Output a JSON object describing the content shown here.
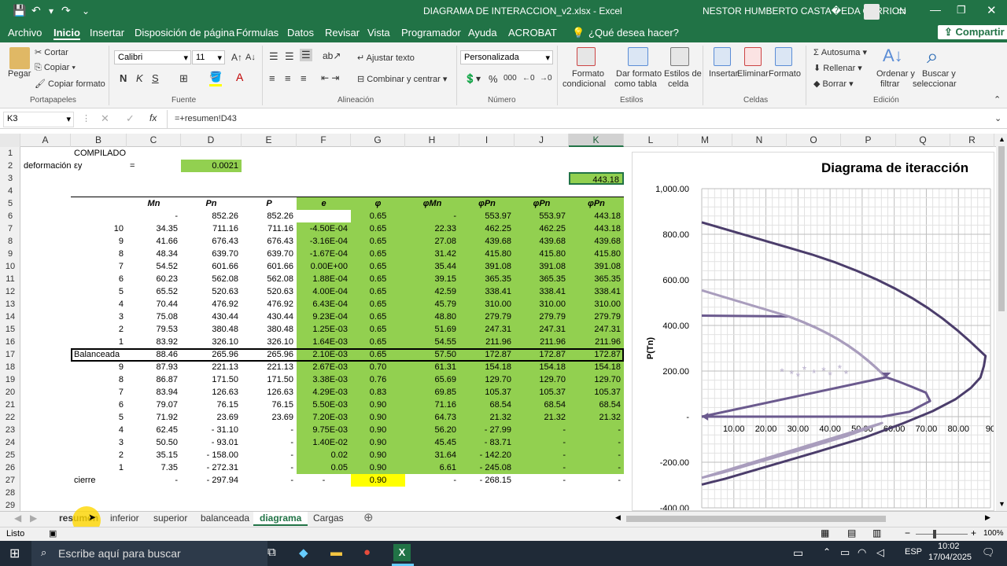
{
  "titlebar": {
    "filename": "DIAGRAMA DE INTERACCION_v2.xlsx - Excel",
    "user": "NESTOR HUMBERTO CASTA�EDA CARRION"
  },
  "menu": [
    "Archivo",
    "Inicio",
    "Insertar",
    "Disposición de página",
    "Fórmulas",
    "Datos",
    "Revisar",
    "Vista",
    "Programador",
    "Ayuda",
    "ACROBAT"
  ],
  "search": "¿Qué desea hacer?",
  "share": "Compartir",
  "ribbon": {
    "cortar": "Cortar",
    "copiar": "Copiar",
    "copiar_formato": "Copiar formato",
    "pegar": "Pegar",
    "portapapeles": "Portapapeles",
    "font": "Calibri",
    "size": "11",
    "fuente": "Fuente",
    "ajustar": "Ajustar texto",
    "combinar": "Combinar y centrar",
    "alineacion": "Alineación",
    "numfmt": "Personalizada",
    "numero": "Número",
    "formato_cond": "Formato",
    "formato_cond2": "condicional",
    "dar_formato": "Dar formato",
    "dar_formato2": "como tabla",
    "estilos_celda": "Estilos de",
    "estilos_celda2": "celda",
    "estilos": "Estilos",
    "insertar": "Insertar",
    "eliminar": "Eliminar",
    "formato": "Formato",
    "celdas": "Celdas",
    "autosuma": "Autosuma",
    "rellenar": "Rellenar",
    "borrar": "Borrar",
    "ordenar": "Ordenar y",
    "ordenar2": "filtrar",
    "buscar": "Buscar y",
    "buscar2": "seleccionar",
    "edicion": "Edición"
  },
  "formula": {
    "namebox": "K3",
    "content": "=+resumen!D43"
  },
  "columns": [
    "A",
    "B",
    "C",
    "D",
    "E",
    "F",
    "G",
    "H",
    "I",
    "J",
    "K",
    "L",
    "M",
    "N",
    "O",
    "P",
    "Q",
    "R"
  ],
  "rows": [
    "1",
    "2",
    "3",
    "4",
    "5",
    "6",
    "7",
    "8",
    "9",
    "10",
    "11",
    "12",
    "13",
    "14",
    "15",
    "16",
    "17",
    "18",
    "19",
    "20",
    "21",
    "22",
    "23",
    "24",
    "25",
    "26",
    "27",
    "28",
    "29"
  ],
  "cells": {
    "b1": "COMPILADO",
    "a2": "deformación",
    "b2": "εy",
    "c2": "=",
    "d2": "0.0021",
    "k3": "443.18",
    "headers": [
      "Mn",
      "Pn",
      "P",
      "e",
      "φ",
      "φMn",
      "φPn",
      "φPn",
      "φPn"
    ]
  },
  "table": [
    [
      "",
      "-",
      "852.26",
      "852.26",
      "",
      "0.65",
      "-",
      "553.97",
      "553.97",
      "443.18"
    ],
    [
      "10",
      "34.35",
      "711.16",
      "711.16",
      "-4.50E-04",
      "0.65",
      "22.33",
      "462.25",
      "462.25",
      "443.18"
    ],
    [
      "9",
      "41.66",
      "676.43",
      "676.43",
      "-3.16E-04",
      "0.65",
      "27.08",
      "439.68",
      "439.68",
      "439.68"
    ],
    [
      "8",
      "48.34",
      "639.70",
      "639.70",
      "-1.67E-04",
      "0.65",
      "31.42",
      "415.80",
      "415.80",
      "415.80"
    ],
    [
      "7",
      "54.52",
      "601.66",
      "601.66",
      "0.00E+00",
      "0.65",
      "35.44",
      "391.08",
      "391.08",
      "391.08"
    ],
    [
      "6",
      "60.23",
      "562.08",
      "562.08",
      "1.88E-04",
      "0.65",
      "39.15",
      "365.35",
      "365.35",
      "365.35"
    ],
    [
      "5",
      "65.52",
      "520.63",
      "520.63",
      "4.00E-04",
      "0.65",
      "42.59",
      "338.41",
      "338.41",
      "338.41"
    ],
    [
      "4",
      "70.44",
      "476.92",
      "476.92",
      "6.43E-04",
      "0.65",
      "45.79",
      "310.00",
      "310.00",
      "310.00"
    ],
    [
      "3",
      "75.08",
      "430.44",
      "430.44",
      "9.23E-04",
      "0.65",
      "48.80",
      "279.79",
      "279.79",
      "279.79"
    ],
    [
      "2",
      "79.53",
      "380.48",
      "380.48",
      "1.25E-03",
      "0.65",
      "51.69",
      "247.31",
      "247.31",
      "247.31"
    ],
    [
      "1",
      "83.92",
      "326.10",
      "326.10",
      "1.64E-03",
      "0.65",
      "54.55",
      "211.96",
      "211.96",
      "211.96"
    ],
    [
      "Balanceada",
      "88.46",
      "265.96",
      "265.96",
      "2.10E-03",
      "0.65",
      "57.50",
      "172.87",
      "172.87",
      "172.87"
    ],
    [
      "9",
      "87.93",
      "221.13",
      "221.13",
      "2.67E-03",
      "0.70",
      "61.31",
      "154.18",
      "154.18",
      "154.18"
    ],
    [
      "8",
      "86.87",
      "171.50",
      "171.50",
      "3.38E-03",
      "0.76",
      "65.69",
      "129.70",
      "129.70",
      "129.70"
    ],
    [
      "7",
      "83.94",
      "126.63",
      "126.63",
      "4.29E-03",
      "0.83",
      "69.85",
      "105.37",
      "105.37",
      "105.37"
    ],
    [
      "6",
      "79.07",
      "76.15",
      "76.15",
      "5.50E-03",
      "0.90",
      "71.16",
      "68.54",
      "68.54",
      "68.54"
    ],
    [
      "5",
      "71.92",
      "23.69",
      "23.69",
      "7.20E-03",
      "0.90",
      "64.73",
      "21.32",
      "21.32",
      "21.32"
    ],
    [
      "4",
      "62.45",
      "-   31.10",
      "-",
      "9.75E-03",
      "0.90",
      "56.20",
      "-   27.99",
      "-",
      "-"
    ],
    [
      "3",
      "50.50",
      "-   93.01",
      "-",
      "1.40E-02",
      "0.90",
      "45.45",
      "-   83.71",
      "-",
      "-"
    ],
    [
      "2",
      "35.15",
      "-  158.00",
      "-",
      "0.02",
      "0.90",
      "31.64",
      "-  142.20",
      "-",
      "-"
    ],
    [
      "1",
      "7.35",
      "-  272.31",
      "-",
      "0.05",
      "0.90",
      "6.61",
      "-  245.08",
      "-",
      "-"
    ],
    [
      "cierre",
      "-",
      "-   297.94",
      "-",
      "-",
      "0.90",
      "-",
      "-  268.15",
      "-",
      "-"
    ]
  ],
  "chart_data": {
    "type": "line",
    "title": "Diagrama de iteracción",
    "ylabel": "P(Tn)",
    "xlabel": "",
    "xticks": [
      "10.00",
      "20.00",
      "30.00",
      "40.00",
      "50.00",
      "60.00",
      "70.00",
      "80.00",
      "90"
    ],
    "yticks": [
      "1,000.00",
      "800.00",
      "600.00",
      "400.00",
      "200.00",
      "-",
      "-200.00",
      "-400.00"
    ],
    "xlim": [
      0,
      90
    ],
    "ylim": [
      -400,
      1000
    ],
    "series": [
      {
        "color": "#4b3d6b",
        "x": [
          0,
          34.35,
          41.66,
          48.34,
          54.52,
          60.23,
          65.52,
          70.44,
          75.08,
          79.53,
          83.92,
          88.46,
          87.93,
          86.87,
          83.94,
          79.07,
          71.92,
          62.45,
          50.5,
          35.15,
          7.35,
          0
        ],
        "y": [
          852.26,
          711.16,
          676.43,
          639.7,
          601.66,
          562.08,
          520.63,
          476.92,
          430.44,
          380.48,
          326.1,
          265.96,
          221.13,
          171.5,
          126.63,
          76.15,
          23.69,
          -31.1,
          -93.01,
          -158,
          -272.31,
          -297.94
        ]
      },
      {
        "color": "#6b5a8e",
        "x": [
          0,
          27.08,
          31.42,
          35.44,
          39.15,
          42.59,
          45.79,
          48.8,
          51.69,
          54.55,
          57.5,
          61.31,
          65.69,
          69.85,
          71.16,
          64.73,
          56.2,
          0
        ],
        "y": [
          443.18,
          439.68,
          415.8,
          391.08,
          365.35,
          338.41,
          310,
          279.79,
          247.31,
          211.96,
          172.87,
          154.18,
          129.7,
          105.37,
          68.54,
          21.32,
          0,
          0
        ]
      },
      {
        "color": "#a99dbd",
        "x": [
          0,
          27.08,
          31.42,
          35.44,
          39.15,
          42.59,
          45.79,
          48.8,
          51.69,
          54.55,
          57.5
        ],
        "y": [
          553.97,
          439.68,
          415.8,
          391.08,
          365.35,
          338.41,
          310,
          279.79,
          247.31,
          211.96,
          172.87
        ]
      },
      {
        "color": "#6b5a8e",
        "x": [
          0,
          57.5
        ],
        "y": [
          0,
          172.87
        ]
      },
      {
        "color": "#a99dbd",
        "x": [
          0,
          56.2,
          45.45,
          31.64,
          6.61,
          0
        ],
        "y": [
          -268.15,
          -27.99,
          -83.71,
          -142.2,
          -245.08,
          -268.15
        ]
      }
    ],
    "markers": [
      {
        "x": 25,
        "y": 180,
        "label": "*"
      },
      {
        "x": 28,
        "y": 170,
        "label": "*"
      },
      {
        "x": 30,
        "y": 160,
        "label": "*"
      },
      {
        "x": 32,
        "y": 190,
        "label": "*"
      },
      {
        "x": 35,
        "y": 175,
        "label": "*"
      },
      {
        "x": 38,
        "y": 185,
        "label": "*"
      },
      {
        "x": 40,
        "y": 165,
        "label": "*"
      },
      {
        "x": 43,
        "y": 195,
        "label": "*"
      },
      {
        "x": 45,
        "y": 170,
        "label": "*"
      }
    ]
  },
  "tabs": [
    "resumen",
    "inferior",
    "superior",
    "balanceada",
    "diagrama",
    "Cargas"
  ],
  "active_tab": "diagrama",
  "status": {
    "ready": "Listo",
    "zoom": "100%"
  },
  "taskbar": {
    "search": "Escribe aquí para buscar",
    "lang": "ESP",
    "time": "10:02",
    "date": "17/04/2025"
  }
}
